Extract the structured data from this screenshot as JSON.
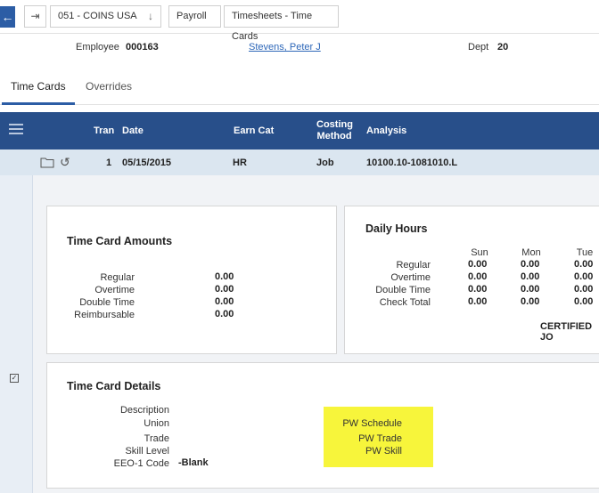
{
  "breadcrumb": {
    "back_icon": "arrow-left-icon",
    "nav_icon": "enter-icon",
    "company": "051 - COINS USA",
    "module": "Payroll",
    "page": "Timesheets - Time Cards"
  },
  "employee": {
    "label": "Employee",
    "number": "000163",
    "name": "Stevens, Peter J",
    "dept_label": "Dept",
    "dept_value": "20"
  },
  "tabs": [
    {
      "label": "Time Cards",
      "active": true
    },
    {
      "label": "Overrides",
      "active": false
    }
  ],
  "grid": {
    "headers": {
      "tran": "Tran",
      "date": "Date",
      "earn_cat": "Earn Cat",
      "costing_line1": "Costing",
      "costing_line2": "Method",
      "analysis": "Analysis"
    },
    "row": {
      "tran": "1",
      "date": "05/15/2015",
      "earn_cat": "HR",
      "costing": "Job",
      "analysis": "10100.10-1081010.L"
    }
  },
  "amounts": {
    "title": "Time Card Amounts",
    "rows": [
      {
        "label": "Regular",
        "value": "0.00"
      },
      {
        "label": "Overtime",
        "value": "0.00"
      },
      {
        "label": "Double Time",
        "value": "0.00"
      },
      {
        "label": "Reimbursable",
        "value": "0.00"
      }
    ]
  },
  "daily": {
    "title": "Daily Hours",
    "days": [
      "Sun",
      "Mon",
      "Tue"
    ],
    "rows": [
      {
        "label": "Regular",
        "values": [
          "0.00",
          "0.00",
          "0.00"
        ]
      },
      {
        "label": "Overtime",
        "values": [
          "0.00",
          "0.00",
          "0.00"
        ]
      },
      {
        "label": "Double Time",
        "values": [
          "0.00",
          "0.00",
          "0.00"
        ]
      },
      {
        "label": "Check Total",
        "values": [
          "0.00",
          "0.00",
          "0.00"
        ]
      }
    ],
    "certified": "CERTIFIED JO"
  },
  "details": {
    "title": "Time Card Details",
    "labels": [
      "Description",
      "Union",
      "Trade",
      "Skill Level",
      "EEO-1 Code"
    ],
    "eeo_value": "-Blank",
    "pw_schedule": "PW Schedule",
    "pw_trade": "PW Trade",
    "pw_skill": "PW Skill"
  }
}
